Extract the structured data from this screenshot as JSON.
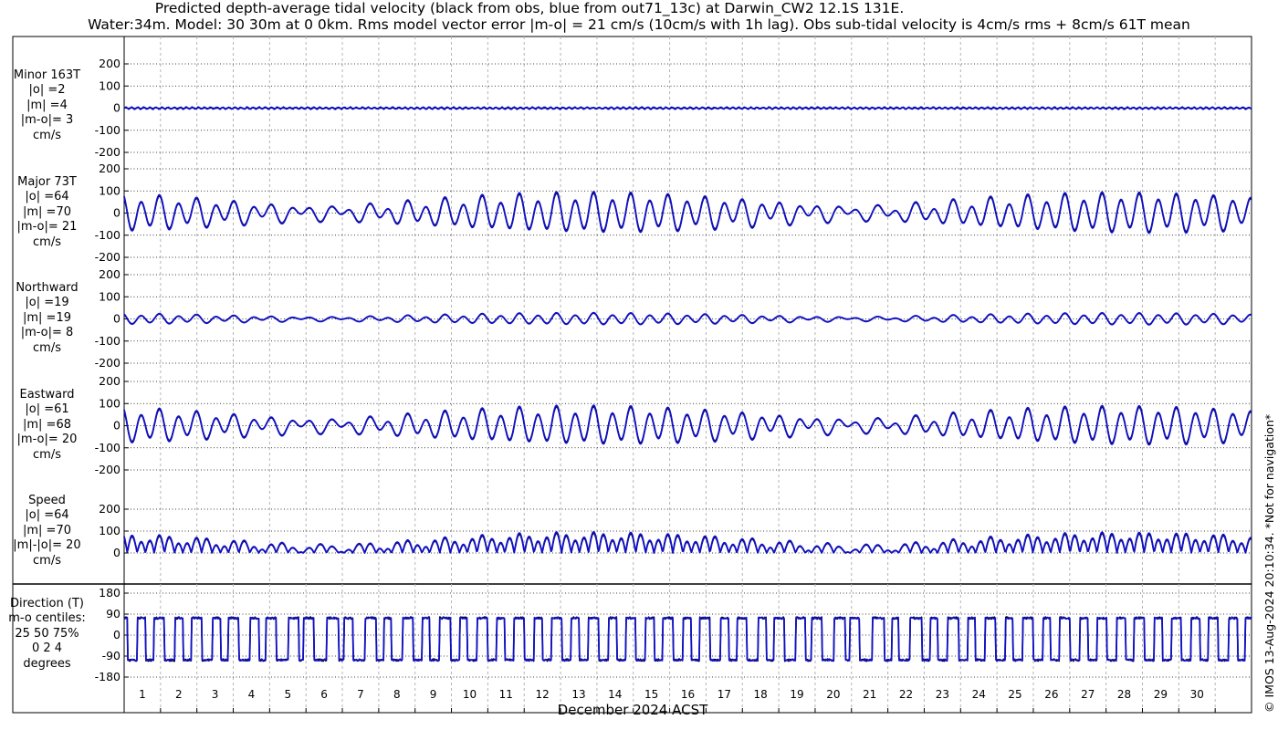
{
  "title_line1": "Predicted depth-average tidal velocity (black from obs, blue from out71_13c) at Darwin_CW2 12.1S 131E.",
  "title_line2": "Water:34m. Model: 30 30m at 0 0km. Rms model vector error |m-o| = 21 cm/s (10cm/s with 1h lag). Obs sub-tidal velocity is 4cm/s rms + 8cm/s 61T mean",
  "xlabel": "December 2024 ACST",
  "copyright": "© IMOS 13-Aug-2024 20:10:34. *Not for navigation*",
  "colors": {
    "obs": "#000000",
    "model": "#1010c8",
    "grid": "#b4b4b4"
  },
  "chart_data": [
    {
      "type": "line",
      "panel": "minor",
      "label_lines": [
        "Minor 163T",
        "|o| =2",
        "|m| =4",
        "|m-o|= 3",
        "cm/s"
      ],
      "ylim": [
        -200,
        200
      ],
      "yticks": [
        -200,
        -100,
        0,
        100,
        200
      ],
      "x_range_days": [
        0,
        31
      ],
      "xticks": [
        1,
        2,
        3,
        4,
        5,
        6,
        7,
        8,
        9,
        10,
        11,
        12,
        13,
        14,
        15,
        16,
        17,
        18,
        19,
        20,
        21,
        22,
        23,
        24,
        25,
        26,
        27,
        28,
        29,
        30
      ],
      "series": [
        {
          "source": "obs",
          "rms": 2
        },
        {
          "source": "model",
          "rms": 4
        }
      ]
    },
    {
      "type": "line",
      "panel": "major",
      "label_lines": [
        "Major 73T",
        "|o| =64",
        "|m| =70",
        "|m-o|= 21",
        "cm/s"
      ],
      "ylim": [
        -200,
        200
      ],
      "yticks": [
        -200,
        -100,
        0,
        100,
        200
      ],
      "x_range_days": [
        0,
        31
      ],
      "xticks": [
        1,
        2,
        3,
        4,
        5,
        6,
        7,
        8,
        9,
        10,
        11,
        12,
        13,
        14,
        15,
        16,
        17,
        18,
        19,
        20,
        21,
        22,
        23,
        24,
        25,
        26,
        27,
        28,
        29,
        30
      ],
      "series": [
        {
          "source": "obs",
          "rms": 64
        },
        {
          "source": "model",
          "rms": 70
        }
      ]
    },
    {
      "type": "line",
      "panel": "northward",
      "label_lines": [
        "Northward",
        "|o| =19",
        "|m| =19",
        "|m-o|= 8",
        "cm/s"
      ],
      "ylim": [
        -200,
        200
      ],
      "yticks": [
        -200,
        -100,
        0,
        100,
        200
      ],
      "x_range_days": [
        0,
        31
      ],
      "xticks": [
        1,
        2,
        3,
        4,
        5,
        6,
        7,
        8,
        9,
        10,
        11,
        12,
        13,
        14,
        15,
        16,
        17,
        18,
        19,
        20,
        21,
        22,
        23,
        24,
        25,
        26,
        27,
        28,
        29,
        30
      ],
      "series": [
        {
          "source": "obs",
          "rms": 19
        },
        {
          "source": "model",
          "rms": 19
        }
      ]
    },
    {
      "type": "line",
      "panel": "eastward",
      "label_lines": [
        "Eastward",
        "|o| =61",
        "|m| =68",
        "|m-o|= 20",
        "cm/s"
      ],
      "ylim": [
        -200,
        200
      ],
      "yticks": [
        -200,
        -100,
        0,
        100,
        200
      ],
      "x_range_days": [
        0,
        31
      ],
      "xticks": [
        1,
        2,
        3,
        4,
        5,
        6,
        7,
        8,
        9,
        10,
        11,
        12,
        13,
        14,
        15,
        16,
        17,
        18,
        19,
        20,
        21,
        22,
        23,
        24,
        25,
        26,
        27,
        28,
        29,
        30
      ],
      "series": [
        {
          "source": "obs",
          "rms": 61
        },
        {
          "source": "model",
          "rms": 68
        }
      ]
    },
    {
      "type": "line",
      "panel": "speed",
      "label_lines": [
        "Speed",
        "|o| =64",
        "|m| =70",
        "|m|-|o|= 20",
        "cm/s"
      ],
      "ylim": [
        0,
        200
      ],
      "yticks": [
        0,
        100,
        200
      ],
      "x_range_days": [
        0,
        31
      ],
      "xticks": [
        1,
        2,
        3,
        4,
        5,
        6,
        7,
        8,
        9,
        10,
        11,
        12,
        13,
        14,
        15,
        16,
        17,
        18,
        19,
        20,
        21,
        22,
        23,
        24,
        25,
        26,
        27,
        28,
        29,
        30
      ],
      "series": [
        {
          "source": "obs",
          "rms": 64
        },
        {
          "source": "model",
          "rms": 70
        }
      ]
    },
    {
      "type": "line",
      "panel": "direction",
      "label_lines": [
        "Direction (T)",
        "m-o centiles:",
        "25  50  75%",
        "0  2  4",
        "degrees"
      ],
      "ylim": [
        -180,
        180
      ],
      "yticks": [
        -180,
        -90,
        0,
        90,
        180
      ],
      "x_range_days": [
        0,
        31
      ],
      "xticks": [
        1,
        2,
        3,
        4,
        5,
        6,
        7,
        8,
        9,
        10,
        11,
        12,
        13,
        14,
        15,
        16,
        17,
        18,
        19,
        20,
        21,
        22,
        23,
        24,
        25,
        26,
        27,
        28,
        29,
        30
      ],
      "series": [
        {
          "source": "obs",
          "flood_deg": 73,
          "ebb_deg": -107
        },
        {
          "source": "model",
          "flood_deg": 73,
          "ebb_deg": -107
        }
      ]
    }
  ]
}
